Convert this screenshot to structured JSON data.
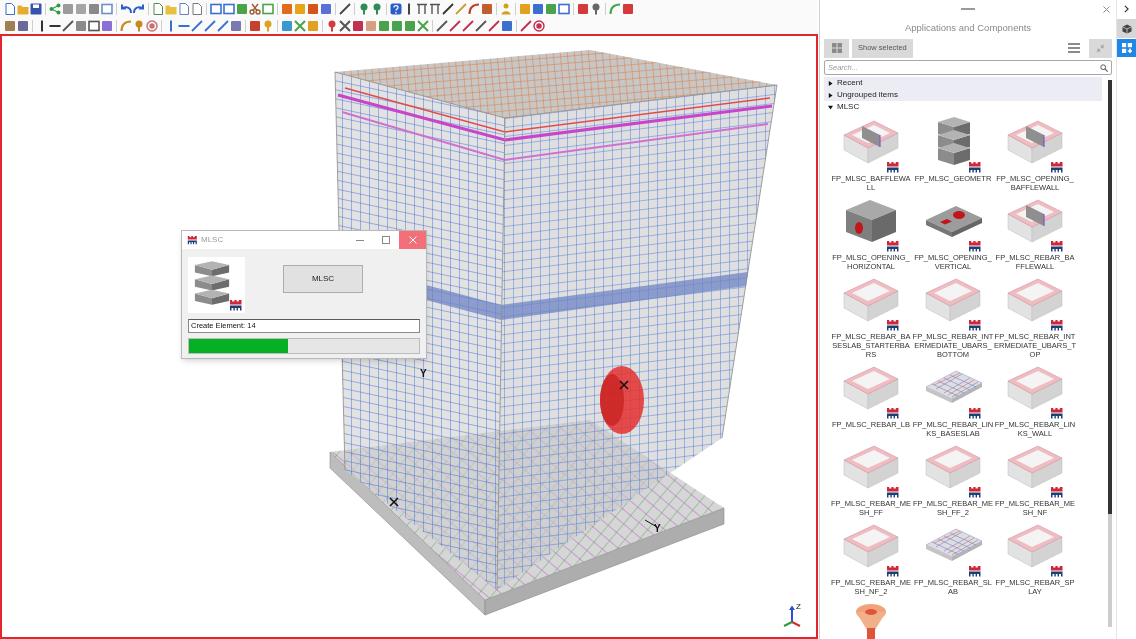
{
  "viewport": {
    "axis_labels": [
      "Y",
      "Y"
    ],
    "triad_label": "Z"
  },
  "dialog": {
    "title": "MLSC",
    "button": "MLSC",
    "status": "Create Element: 14",
    "progress": {
      "level": 0.43
    }
  },
  "panel": {
    "title": "Applications and Components",
    "show_selected": "Show selected",
    "search": {
      "placeholder": "Search..."
    },
    "tree": [
      {
        "label": "Recent",
        "expanded": false,
        "selected": true
      },
      {
        "label": "Ungrouped items",
        "expanded": false,
        "selected": true
      },
      {
        "label": "MLSC",
        "expanded": true,
        "selected": false
      }
    ],
    "components": [
      {
        "label": "FP_MLSC_BAFFLEWALL",
        "kind": "wall"
      },
      {
        "label": "FP_MLSC_GEOMETR",
        "kind": "block"
      },
      {
        "label": "FP_MLSC_OPENING_BAFFLEWALL",
        "kind": "wall"
      },
      {
        "label": "FP_MLSC_OPENING_HORIZONTAL",
        "kind": "solid"
      },
      {
        "label": "FP_MLSC_OPENING_VERTICAL",
        "kind": "plate"
      },
      {
        "label": "FP_MLSC_REBAR_BAFFLEWALL",
        "kind": "wall"
      },
      {
        "label": "FP_MLSC_REBAR_BASESLAB_STARTERBARS",
        "kind": "frame"
      },
      {
        "label": "FP_MLSC_REBAR_INTERMEDIATE_UBARS_BOTTOM",
        "kind": "frame"
      },
      {
        "label": "FP_MLSC_REBAR_INTERMEDIATE_UBARS_TOP",
        "kind": "frame"
      },
      {
        "label": "FP_MLSC_REBAR_LB",
        "kind": "frame"
      },
      {
        "label": "FP_MLSC_REBAR_LINKS_BASESLAB",
        "kind": "slab"
      },
      {
        "label": "FP_MLSC_REBAR_LINKS_WALL",
        "kind": "frame"
      },
      {
        "label": "FP_MLSC_REBAR_MESH_FF",
        "kind": "frame"
      },
      {
        "label": "FP_MLSC_REBAR_MESH_FF_2",
        "kind": "frame"
      },
      {
        "label": "FP_MLSC_REBAR_MESH_NF",
        "kind": "frame"
      },
      {
        "label": "FP_MLSC_REBAR_MESH_NF_2",
        "kind": "frame"
      },
      {
        "label": "FP_MLSC_REBAR_SLAB",
        "kind": "slab"
      },
      {
        "label": "FP_MLSC_REBAR_SPLAY",
        "kind": "frame"
      },
      {
        "kind": "cone"
      }
    ]
  }
}
